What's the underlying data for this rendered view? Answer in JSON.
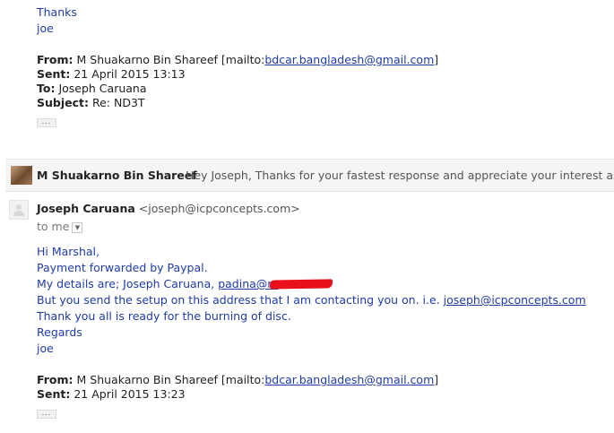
{
  "quoted1": {
    "thanks": "Thanks",
    "sign": "joe",
    "from_label": "From:",
    "from_name": "M Shuakarno Bin Shareef [mailto:",
    "from_email": "bdcar.bangladesh@gmail.com",
    "from_close": "]",
    "sent_label": "Sent:",
    "sent_value": "21 April 2015 13:13",
    "to_label": "To:",
    "to_value": "Joseph Caruana",
    "subject_label": "Subject:",
    "subject_value": "Re: ND3T"
  },
  "collapsed": {
    "sender": "M Shuakarno Bin Shareef",
    "snippet": "Hey Joseph, Thanks for your fastest response and appreciate your interest as ..."
  },
  "message": {
    "sender": "Joseph Caruana",
    "sender_email": "<joseph@icpconcepts.com>",
    "to_me": "to me",
    "greeting": "Hi Marshal,",
    "line1": "Payment forwarded by Paypal.",
    "line2_prefix": "My details are; Joseph Caruana,",
    "line2_link": "padina@m",
    "line3_prefix": "But you send the setup on this address that I am contacting you on. i.e.",
    "line3_link": "joseph@icpconcepts.com",
    "line4": "Thank you all is ready for the burning of disc.",
    "regards": "Regards",
    "sign": "joe",
    "from_label": "From:",
    "from_name": "M Shuakarno Bin Shareef [mailto:",
    "from_email": "bdcar.bangladesh@gmail.com",
    "from_close": "]",
    "sent_label": "Sent:",
    "sent_value": "21 April 2015 13:23"
  },
  "icons": {
    "ellipsis": "...",
    "dropdown": "▼"
  }
}
